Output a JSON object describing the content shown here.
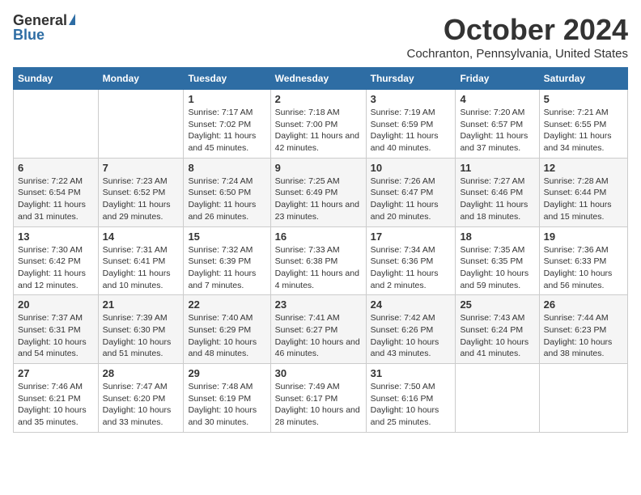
{
  "header": {
    "logo_general": "General",
    "logo_blue": "Blue",
    "month_title": "October 2024",
    "location": "Cochranton, Pennsylvania, United States"
  },
  "days_of_week": [
    "Sunday",
    "Monday",
    "Tuesday",
    "Wednesday",
    "Thursday",
    "Friday",
    "Saturday"
  ],
  "weeks": [
    [
      {
        "day": "",
        "sunrise": "",
        "sunset": "",
        "daylight": ""
      },
      {
        "day": "",
        "sunrise": "",
        "sunset": "",
        "daylight": ""
      },
      {
        "day": "1",
        "sunrise": "Sunrise: 7:17 AM",
        "sunset": "Sunset: 7:02 PM",
        "daylight": "Daylight: 11 hours and 45 minutes."
      },
      {
        "day": "2",
        "sunrise": "Sunrise: 7:18 AM",
        "sunset": "Sunset: 7:00 PM",
        "daylight": "Daylight: 11 hours and 42 minutes."
      },
      {
        "day": "3",
        "sunrise": "Sunrise: 7:19 AM",
        "sunset": "Sunset: 6:59 PM",
        "daylight": "Daylight: 11 hours and 40 minutes."
      },
      {
        "day": "4",
        "sunrise": "Sunrise: 7:20 AM",
        "sunset": "Sunset: 6:57 PM",
        "daylight": "Daylight: 11 hours and 37 minutes."
      },
      {
        "day": "5",
        "sunrise": "Sunrise: 7:21 AM",
        "sunset": "Sunset: 6:55 PM",
        "daylight": "Daylight: 11 hours and 34 minutes."
      }
    ],
    [
      {
        "day": "6",
        "sunrise": "Sunrise: 7:22 AM",
        "sunset": "Sunset: 6:54 PM",
        "daylight": "Daylight: 11 hours and 31 minutes."
      },
      {
        "day": "7",
        "sunrise": "Sunrise: 7:23 AM",
        "sunset": "Sunset: 6:52 PM",
        "daylight": "Daylight: 11 hours and 29 minutes."
      },
      {
        "day": "8",
        "sunrise": "Sunrise: 7:24 AM",
        "sunset": "Sunset: 6:50 PM",
        "daylight": "Daylight: 11 hours and 26 minutes."
      },
      {
        "day": "9",
        "sunrise": "Sunrise: 7:25 AM",
        "sunset": "Sunset: 6:49 PM",
        "daylight": "Daylight: 11 hours and 23 minutes."
      },
      {
        "day": "10",
        "sunrise": "Sunrise: 7:26 AM",
        "sunset": "Sunset: 6:47 PM",
        "daylight": "Daylight: 11 hours and 20 minutes."
      },
      {
        "day": "11",
        "sunrise": "Sunrise: 7:27 AM",
        "sunset": "Sunset: 6:46 PM",
        "daylight": "Daylight: 11 hours and 18 minutes."
      },
      {
        "day": "12",
        "sunrise": "Sunrise: 7:28 AM",
        "sunset": "Sunset: 6:44 PM",
        "daylight": "Daylight: 11 hours and 15 minutes."
      }
    ],
    [
      {
        "day": "13",
        "sunrise": "Sunrise: 7:30 AM",
        "sunset": "Sunset: 6:42 PM",
        "daylight": "Daylight: 11 hours and 12 minutes."
      },
      {
        "day": "14",
        "sunrise": "Sunrise: 7:31 AM",
        "sunset": "Sunset: 6:41 PM",
        "daylight": "Daylight: 11 hours and 10 minutes."
      },
      {
        "day": "15",
        "sunrise": "Sunrise: 7:32 AM",
        "sunset": "Sunset: 6:39 PM",
        "daylight": "Daylight: 11 hours and 7 minutes."
      },
      {
        "day": "16",
        "sunrise": "Sunrise: 7:33 AM",
        "sunset": "Sunset: 6:38 PM",
        "daylight": "Daylight: 11 hours and 4 minutes."
      },
      {
        "day": "17",
        "sunrise": "Sunrise: 7:34 AM",
        "sunset": "Sunset: 6:36 PM",
        "daylight": "Daylight: 11 hours and 2 minutes."
      },
      {
        "day": "18",
        "sunrise": "Sunrise: 7:35 AM",
        "sunset": "Sunset: 6:35 PM",
        "daylight": "Daylight: 10 hours and 59 minutes."
      },
      {
        "day": "19",
        "sunrise": "Sunrise: 7:36 AM",
        "sunset": "Sunset: 6:33 PM",
        "daylight": "Daylight: 10 hours and 56 minutes."
      }
    ],
    [
      {
        "day": "20",
        "sunrise": "Sunrise: 7:37 AM",
        "sunset": "Sunset: 6:31 PM",
        "daylight": "Daylight: 10 hours and 54 minutes."
      },
      {
        "day": "21",
        "sunrise": "Sunrise: 7:39 AM",
        "sunset": "Sunset: 6:30 PM",
        "daylight": "Daylight: 10 hours and 51 minutes."
      },
      {
        "day": "22",
        "sunrise": "Sunrise: 7:40 AM",
        "sunset": "Sunset: 6:29 PM",
        "daylight": "Daylight: 10 hours and 48 minutes."
      },
      {
        "day": "23",
        "sunrise": "Sunrise: 7:41 AM",
        "sunset": "Sunset: 6:27 PM",
        "daylight": "Daylight: 10 hours and 46 minutes."
      },
      {
        "day": "24",
        "sunrise": "Sunrise: 7:42 AM",
        "sunset": "Sunset: 6:26 PM",
        "daylight": "Daylight: 10 hours and 43 minutes."
      },
      {
        "day": "25",
        "sunrise": "Sunrise: 7:43 AM",
        "sunset": "Sunset: 6:24 PM",
        "daylight": "Daylight: 10 hours and 41 minutes."
      },
      {
        "day": "26",
        "sunrise": "Sunrise: 7:44 AM",
        "sunset": "Sunset: 6:23 PM",
        "daylight": "Daylight: 10 hours and 38 minutes."
      }
    ],
    [
      {
        "day": "27",
        "sunrise": "Sunrise: 7:46 AM",
        "sunset": "Sunset: 6:21 PM",
        "daylight": "Daylight: 10 hours and 35 minutes."
      },
      {
        "day": "28",
        "sunrise": "Sunrise: 7:47 AM",
        "sunset": "Sunset: 6:20 PM",
        "daylight": "Daylight: 10 hours and 33 minutes."
      },
      {
        "day": "29",
        "sunrise": "Sunrise: 7:48 AM",
        "sunset": "Sunset: 6:19 PM",
        "daylight": "Daylight: 10 hours and 30 minutes."
      },
      {
        "day": "30",
        "sunrise": "Sunrise: 7:49 AM",
        "sunset": "Sunset: 6:17 PM",
        "daylight": "Daylight: 10 hours and 28 minutes."
      },
      {
        "day": "31",
        "sunrise": "Sunrise: 7:50 AM",
        "sunset": "Sunset: 6:16 PM",
        "daylight": "Daylight: 10 hours and 25 minutes."
      },
      {
        "day": "",
        "sunrise": "",
        "sunset": "",
        "daylight": ""
      },
      {
        "day": "",
        "sunrise": "",
        "sunset": "",
        "daylight": ""
      }
    ]
  ]
}
